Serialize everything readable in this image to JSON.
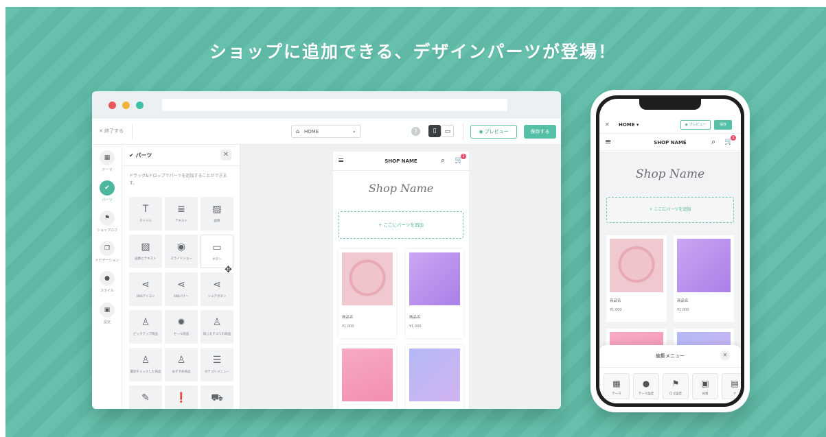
{
  "headline": "ショップに追加できる、デザインパーツが登場！",
  "colors": {
    "teal_bg": "#66c0ad",
    "accent": "#4db69f",
    "badge": "#e8516e"
  },
  "toolbar": {
    "exit_label": "✕ 終了する",
    "page_select": "HOME",
    "preview_label": "◉ プレビュー",
    "save_label": "保存する"
  },
  "leftnav": [
    {
      "icon": "theme-icon",
      "glyph": "▦",
      "label": "テーマ",
      "active": false
    },
    {
      "icon": "parts-icon",
      "glyph": "✔",
      "label": "パーツ",
      "active": true
    },
    {
      "icon": "flag-icon",
      "glyph": "⚑",
      "label": "ショップロゴ",
      "active": false
    },
    {
      "icon": "layers-icon",
      "glyph": "❐",
      "label": "ナビゲーション",
      "active": false
    },
    {
      "icon": "palette-icon",
      "glyph": "●",
      "label": "スタイル",
      "active": false
    },
    {
      "icon": "settings-icon",
      "glyph": "▣",
      "label": "設定",
      "active": false
    }
  ],
  "parts_panel": {
    "title": "✔ パーツ",
    "close": "✕",
    "description": "ドラッグ&ドロップでパーツを追加することができます。",
    "tiles": [
      {
        "glyph": "T",
        "label": "タイトル",
        "icon": "title-icon"
      },
      {
        "glyph": "≣",
        "label": "テキスト",
        "icon": "text-icon"
      },
      {
        "glyph": "▨",
        "label": "画像",
        "icon": "image-icon"
      },
      {
        "glyph": "▨",
        "label": "画像とテキスト",
        "icon": "image-text-icon"
      },
      {
        "glyph": "◉",
        "label": "スライドショー",
        "icon": "slideshow-icon"
      },
      {
        "glyph": "▭",
        "label": "ボタン",
        "icon": "button-icon"
      },
      {
        "glyph": "⋖",
        "label": "SNSアイコン",
        "icon": "share-icon"
      },
      {
        "glyph": "⋖",
        "label": "SNSバナー",
        "icon": "share-icon"
      },
      {
        "glyph": "⋖",
        "label": "シェアボタン",
        "icon": "share-icon"
      },
      {
        "glyph": "♙",
        "label": "ピックアップ商品",
        "icon": "shirt-icon"
      },
      {
        "glyph": "✹",
        "label": "セール商品",
        "icon": "sale-icon"
      },
      {
        "glyph": "♙",
        "label": "同じカテゴリの商品",
        "icon": "shirt-icon"
      },
      {
        "glyph": "♙",
        "label": "最近チェックした商品",
        "icon": "shirt-icon"
      },
      {
        "glyph": "♙",
        "label": "おすすめ商品",
        "icon": "shirt-icon"
      },
      {
        "glyph": "☰",
        "label": "カテゴリメニュー",
        "icon": "list-icon"
      },
      {
        "glyph": "✎",
        "label": "",
        "icon": "pencil-icon"
      },
      {
        "glyph": "❗",
        "label": "",
        "icon": "alert-icon"
      },
      {
        "glyph": "⛟",
        "label": "",
        "icon": "truck-icon"
      }
    ]
  },
  "preview": {
    "shop_title": "SHOP NAME",
    "shop_name": "Shop Name",
    "add_parts": "+ ここにパーツを追加",
    "cart_count": "1",
    "products": [
      {
        "name": "商品名",
        "price": "¥1,000"
      },
      {
        "name": "商品名",
        "price": "¥1,000"
      },
      {
        "name": "",
        "price": ""
      },
      {
        "name": "",
        "price": ""
      }
    ]
  },
  "phone": {
    "close": "✕",
    "page": "HOME ▾",
    "preview_label": "◉ プレビュー",
    "save_label": "保存",
    "shop_title": "SHOP NAME",
    "shop_name": "Shop Name",
    "add_parts": "+ ここにパーツを追加",
    "cart_count": "1",
    "products": [
      {
        "name": "商品名",
        "price": "¥1,000"
      },
      {
        "name": "商品名",
        "price": "¥1,000"
      }
    ],
    "sheet": {
      "title": "編集メニュー",
      "close": "✕",
      "items": [
        {
          "glyph": "▦",
          "label": "テーマ",
          "icon": "theme-icon"
        },
        {
          "glyph": "●",
          "label": "テーマ設定",
          "icon": "palette-icon"
        },
        {
          "glyph": "⚑",
          "label": "ロゴ設定",
          "icon": "flag-icon"
        },
        {
          "glyph": "▣",
          "label": "背景",
          "icon": "settings-icon"
        },
        {
          "glyph": "▤",
          "label": "ナ",
          "icon": "nav-icon"
        }
      ]
    }
  }
}
